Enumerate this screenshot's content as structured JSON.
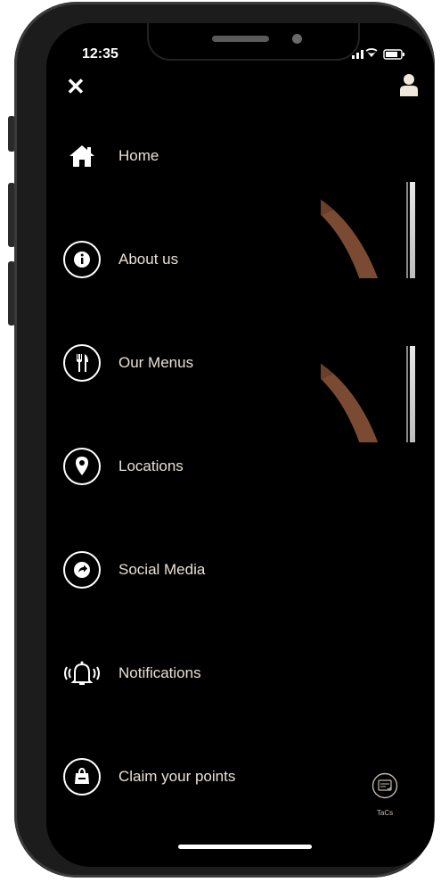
{
  "status_bar": {
    "time": "12:35"
  },
  "menu": {
    "items": [
      {
        "label": "Home",
        "icon": "home-icon"
      },
      {
        "label": "About us",
        "icon": "info-icon"
      },
      {
        "label": "Our Menus",
        "icon": "cutlery-icon"
      },
      {
        "label": "Locations",
        "icon": "location-pin-icon"
      },
      {
        "label": "Social Media",
        "icon": "share-icon"
      },
      {
        "label": "Notifications",
        "icon": "bell-icon"
      },
      {
        "label": "Claim your points",
        "icon": "shopping-bag-icon"
      }
    ]
  },
  "footer": {
    "tacs_label": "TaCs"
  },
  "colors": {
    "background": "#000000",
    "text": "#e8e0d5",
    "icon": "#ffffff"
  }
}
